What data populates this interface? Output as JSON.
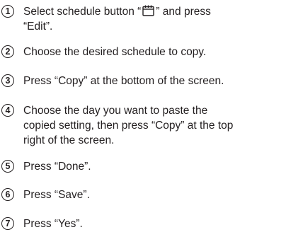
{
  "steps": [
    {
      "number": "1",
      "text_before_icon": "Select schedule button “",
      "icon": "calendar-icon",
      "text_after_icon": "” and press",
      "text_line2": "“Edit”."
    },
    {
      "number": "2",
      "text": "Choose the desired schedule to copy."
    },
    {
      "number": "3",
      "text": "Press “Copy” at the bottom of the screen."
    },
    {
      "number": "4",
      "lines": [
        "Choose the day you want to paste the",
        "copied setting, then press “Copy” at the top",
        "right of the screen."
      ]
    },
    {
      "number": "5",
      "text": "Press “Done”."
    },
    {
      "number": "6",
      "text": "Press “Save”."
    },
    {
      "number": "7",
      "text": "Press “Yes”."
    }
  ]
}
